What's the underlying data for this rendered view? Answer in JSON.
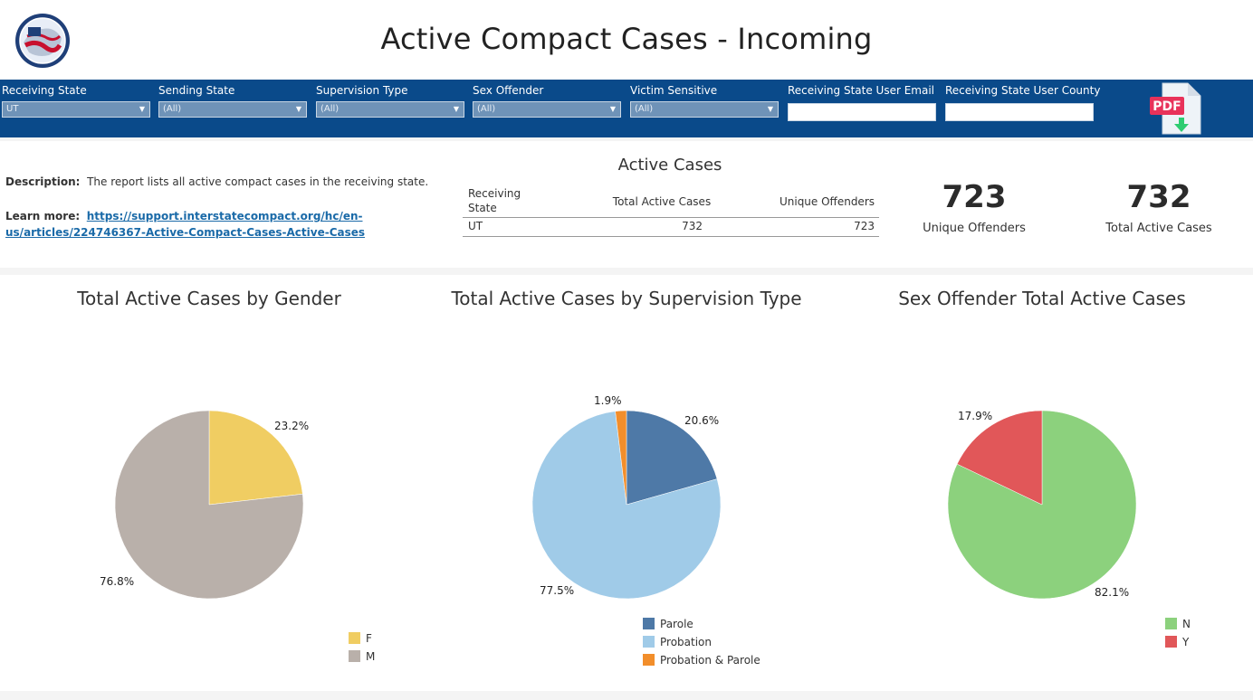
{
  "header": {
    "title": "Active Compact Cases - Incoming"
  },
  "filters": [
    {
      "label": "Receiving State",
      "value": "UT",
      "type": "select"
    },
    {
      "label": "Sending State",
      "value": "(All)",
      "type": "select"
    },
    {
      "label": "Supervision Type",
      "value": "(All)",
      "type": "select"
    },
    {
      "label": "Sex Offender",
      "value": "(All)",
      "type": "select"
    },
    {
      "label": "Victim Sensitive",
      "value": "(All)",
      "type": "select"
    },
    {
      "label": "Receiving State User Email",
      "value": "",
      "type": "input"
    },
    {
      "label": "Receiving State User County",
      "value": "",
      "type": "input"
    }
  ],
  "pdf_icon": {
    "label": "PDF",
    "icon": "pdf-download-icon",
    "color": "#e8325a"
  },
  "info": {
    "description_label": "Description:",
    "description_text": "The report lists all active compact cases in the receiving state.",
    "learn_label": "Learn more:",
    "learn_link": "https://support.interstatecompact.org/hc/en-us/articles/224746367-Active-Compact-Cases-Active-Cases"
  },
  "active_table": {
    "title": "Active Cases",
    "columns": [
      "Receiving State",
      "Total Active Cases",
      "Unique Offenders"
    ],
    "rows": [
      [
        "UT",
        "732",
        "723"
      ]
    ]
  },
  "kpis": [
    {
      "value": "723",
      "label": "Unique Offenders"
    },
    {
      "value": "732",
      "label": "Total Active Cases"
    }
  ],
  "chart_data": [
    {
      "type": "pie",
      "title": "Total Active Cases by Gender",
      "categories": [
        "F",
        "M"
      ],
      "values": [
        23.2,
        76.8
      ],
      "labels": [
        "23.2%",
        "76.8%"
      ],
      "colors": [
        "#f0cd62",
        "#b9b0aa"
      ],
      "legend_position": "bottom-right"
    },
    {
      "type": "pie",
      "title": "Total Active Cases by Supervision Type",
      "categories": [
        "Parole",
        "Probation",
        "Probation & Parole"
      ],
      "values": [
        20.6,
        77.5,
        1.9
      ],
      "labels": [
        "20.6%",
        "77.5%",
        "1.9%"
      ],
      "colors": [
        "#4e79a7",
        "#a0cbe8",
        "#f28e2b"
      ],
      "legend_position": "bottom"
    },
    {
      "type": "pie",
      "title": "Sex Offender Total Active Cases",
      "categories": [
        "N",
        "Y"
      ],
      "values": [
        82.1,
        17.9
      ],
      "labels": [
        "82.1%",
        "17.9%"
      ],
      "colors": [
        "#8cd17d",
        "#e15759"
      ],
      "legend_position": "bottom-right"
    }
  ]
}
